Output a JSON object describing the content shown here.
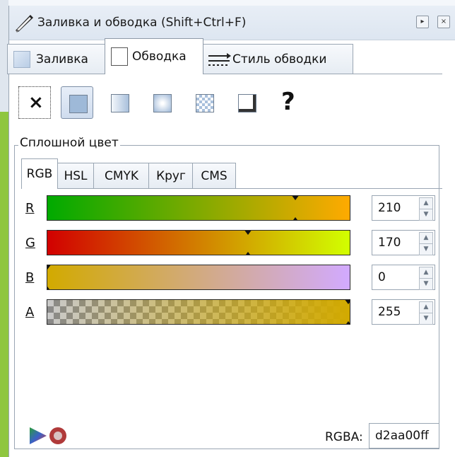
{
  "window": {
    "title": "Заливка и обводка (Shift+Ctrl+F)"
  },
  "tabs": [
    {
      "label": "Заливка"
    },
    {
      "label": "Обводка"
    },
    {
      "label": "Стиль обводки"
    }
  ],
  "paint_modes": [
    {
      "icon": "no-paint-icon",
      "symbol": "×"
    },
    {
      "icon": "flat-color-icon"
    },
    {
      "icon": "linear-gradient-icon"
    },
    {
      "icon": "radial-gradient-icon"
    },
    {
      "icon": "pattern-icon"
    },
    {
      "icon": "swatch-icon"
    },
    {
      "icon": "unset-paint-icon",
      "symbol": "?"
    }
  ],
  "section": {
    "title": "Сплошной цвет"
  },
  "color_tabs": [
    {
      "label": "RGB"
    },
    {
      "label": "HSL"
    },
    {
      "label": "CMYK"
    },
    {
      "label": "Круг"
    },
    {
      "label": "CMS"
    }
  ],
  "channels": [
    {
      "label": "R",
      "value": "210",
      "level": 0.8235
    },
    {
      "label": "G",
      "value": "170",
      "level": 0.6667
    },
    {
      "label": "B",
      "value": "0",
      "level": 0.0
    },
    {
      "label": "A",
      "value": "255",
      "level": 1.0
    }
  ],
  "rgba": {
    "label": "RGBA:",
    "value": "d2aa00ff"
  },
  "colors": {
    "current": "#d2aa00",
    "r_start": "#00aa00",
    "r_end": "#ffaa00",
    "g_start": "#d20000",
    "g_end": "#d2ff00",
    "b_start": "#d2aa00",
    "b_end": "#d2aaff"
  }
}
